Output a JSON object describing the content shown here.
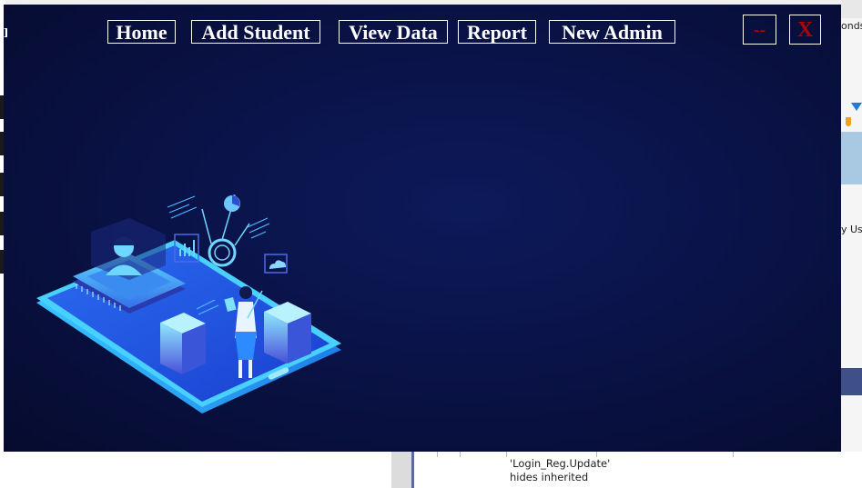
{
  "nav": {
    "items": [
      {
        "label": "Home"
      },
      {
        "label": "Add Student"
      },
      {
        "label": "View Data"
      },
      {
        "label": "Report"
      },
      {
        "label": "New Admin"
      }
    ]
  },
  "window_controls": {
    "minimize_label": "--",
    "close_label": "X"
  },
  "background": {
    "bottom_text": "'Login_Reg.Update' hides inherited",
    "right_text_top": "onds",
    "right_text_mid": "y Us"
  },
  "colors": {
    "window_bg": "#0a1348",
    "nav_text": "#ffffff",
    "control_text": "#b00000",
    "accent": "#3aa8ff"
  },
  "icons": {
    "illustration": "isometric-tech-illustration"
  }
}
